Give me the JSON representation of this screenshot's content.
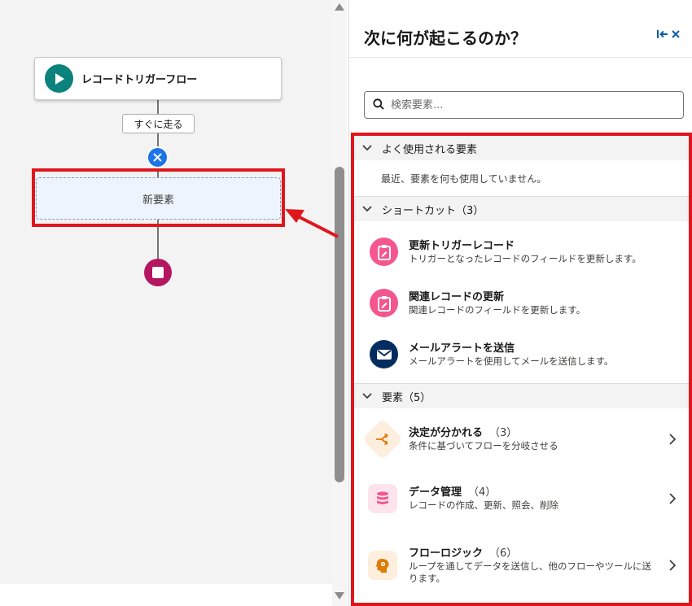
{
  "canvas": {
    "start_label": "レコードトリガーフロー",
    "run_label": "すぐに走る",
    "new_element_label": "新要素"
  },
  "panel": {
    "title": "次に何が起こるのか？",
    "search_placeholder": "検索要素...",
    "frequent": {
      "header": "よく使用される要素",
      "empty_text": "最近、要素を何も使用していません。"
    },
    "shortcuts": {
      "header": "ショートカット（3）",
      "items": [
        {
          "title": "更新トリガーレコード",
          "desc": "トリガーとなったレコードのフィールドを更新します。",
          "icon": "clipboard-edit-icon",
          "color": "#f4578d"
        },
        {
          "title": "関連レコードの更新",
          "desc": "関連レコードのフィールドを更新します。",
          "icon": "clipboard-edit-icon",
          "color": "#f4578d"
        },
        {
          "title": "メールアラートを送信",
          "desc": "メールアラートを使用してメールを送信します。",
          "icon": "email-icon",
          "color": "#032d60"
        }
      ]
    },
    "elements": {
      "header": "要素（5）",
      "items": [
        {
          "title": "決定が分かれる",
          "count": "（3）",
          "desc": "条件に基づいてフローを分岐させる",
          "icon": "branch-icon",
          "color": "#dd7a01"
        },
        {
          "title": "データ管理",
          "count": "（4）",
          "desc": "レコードの作成、更新、照会、削除",
          "icon": "database-icon",
          "color": "#f4578d"
        },
        {
          "title": "フローロジック",
          "count": "（6）",
          "desc": "ループを通してデータを送信し、他のフローやツールに送ります。",
          "icon": "logic-head-icon",
          "color": "#dd7a01"
        }
      ]
    }
  },
  "colors": {
    "highlight": "#e0161c",
    "start_icon": "#0b827c",
    "end_icon": "#b4175f",
    "add_icon": "#1b75e6",
    "brand_blue": "#0b5cab"
  }
}
